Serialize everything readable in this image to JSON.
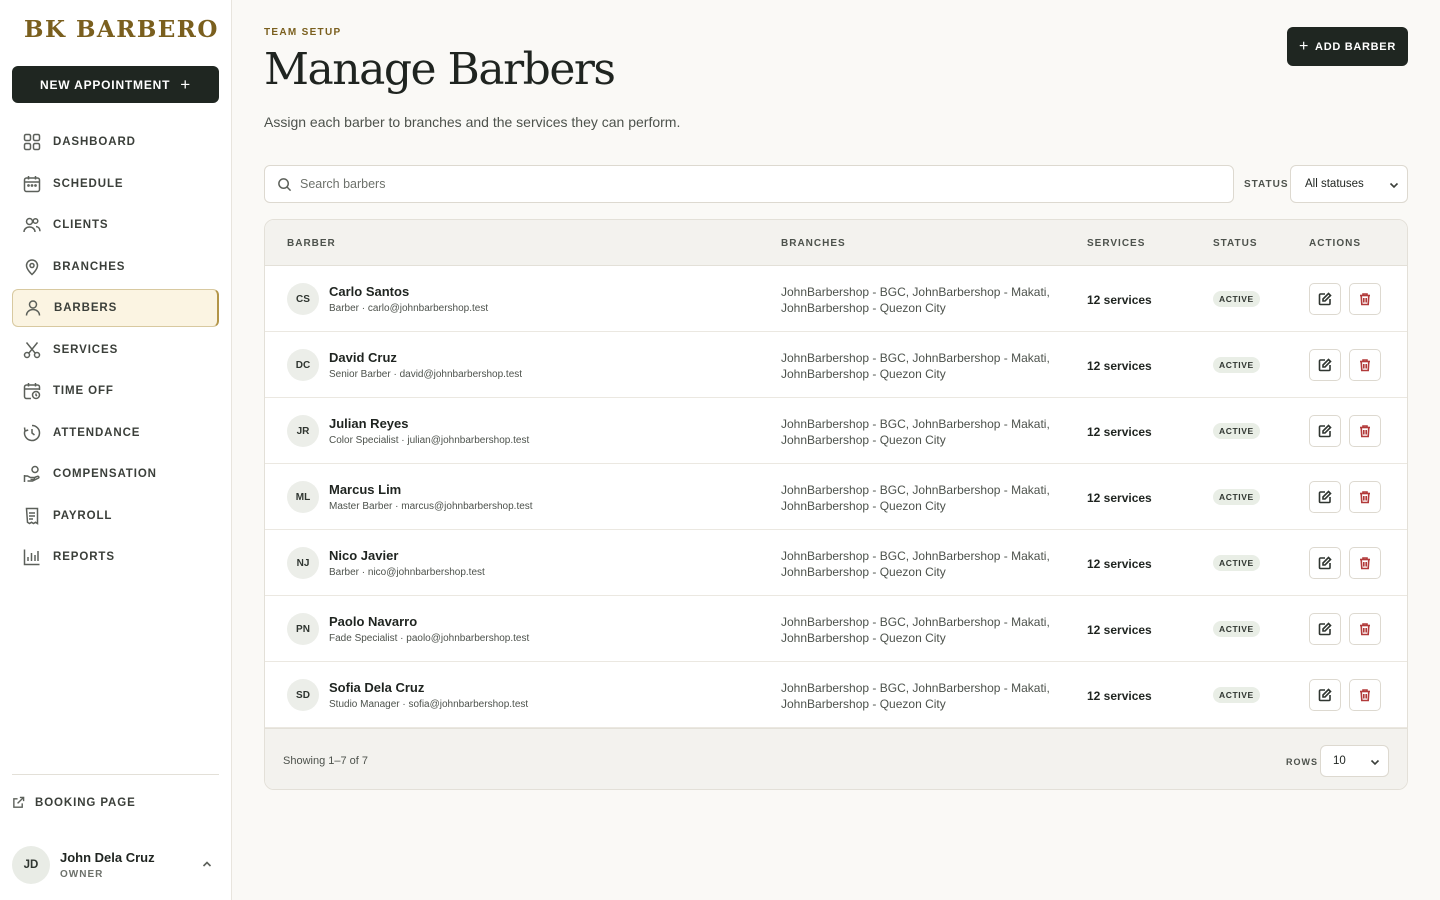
{
  "sidebar": {
    "brand": "BK BARBERO",
    "new_appointment": "NEW APPOINTMENT",
    "nav": [
      {
        "label": "DASHBOARD",
        "icon": "grid-icon"
      },
      {
        "label": "SCHEDULE",
        "icon": "calendar-icon"
      },
      {
        "label": "CLIENTS",
        "icon": "users-icon"
      },
      {
        "label": "BRANCHES",
        "icon": "map-pin-icon"
      },
      {
        "label": "BARBERS",
        "icon": "user-icon",
        "active": true
      },
      {
        "label": "SERVICES",
        "icon": "scissors-icon"
      },
      {
        "label": "TIME OFF",
        "icon": "calendar-clock-icon"
      },
      {
        "label": "ATTENDANCE",
        "icon": "clock-icon"
      },
      {
        "label": "COMPENSATION",
        "icon": "hand-coins-icon"
      },
      {
        "label": "PAYROLL",
        "icon": "receipt-icon"
      },
      {
        "label": "REPORTS",
        "icon": "bar-chart-icon"
      }
    ],
    "booking_page": "BOOKING PAGE",
    "user": {
      "initials": "JD",
      "name": "John Dela Cruz",
      "role": "OWNER"
    }
  },
  "header": {
    "eyebrow": "TEAM SETUP",
    "title": "Manage Barbers",
    "subtitle": "Assign each barber to branches and the services they can perform.",
    "add_button": "ADD BARBER"
  },
  "filters": {
    "search_placeholder": "Search barbers",
    "status_label": "STATUS",
    "status_value": "All statuses"
  },
  "table": {
    "columns": [
      "BARBER",
      "BRANCHES",
      "SERVICES",
      "STATUS",
      "ACTIONS"
    ],
    "rows": [
      {
        "initials": "CS",
        "name": "Carlo Santos",
        "meta": "Barber · carlo@johnbarbershop.test",
        "branches": "JohnBarbershop - BGC, JohnBarbershop - Makati, JohnBarbershop - Quezon City",
        "services": "12 services",
        "status": "ACTIVE"
      },
      {
        "initials": "DC",
        "name": "David Cruz",
        "meta": "Senior Barber · david@johnbarbershop.test",
        "branches": "JohnBarbershop - BGC, JohnBarbershop - Makati, JohnBarbershop - Quezon City",
        "services": "12 services",
        "status": "ACTIVE"
      },
      {
        "initials": "JR",
        "name": "Julian Reyes",
        "meta": "Color Specialist · julian@johnbarbershop.test",
        "branches": "JohnBarbershop - BGC, JohnBarbershop - Makati, JohnBarbershop - Quezon City",
        "services": "12 services",
        "status": "ACTIVE"
      },
      {
        "initials": "ML",
        "name": "Marcus Lim",
        "meta": "Master Barber · marcus@johnbarbershop.test",
        "branches": "JohnBarbershop - BGC, JohnBarbershop - Makati, JohnBarbershop - Quezon City",
        "services": "12 services",
        "status": "ACTIVE"
      },
      {
        "initials": "NJ",
        "name": "Nico Javier",
        "meta": "Barber · nico@johnbarbershop.test",
        "branches": "JohnBarbershop - BGC, JohnBarbershop - Makati, JohnBarbershop - Quezon City",
        "services": "12 services",
        "status": "ACTIVE"
      },
      {
        "initials": "PN",
        "name": "Paolo Navarro",
        "meta": "Fade Specialist · paolo@johnbarbershop.test",
        "branches": "JohnBarbershop - BGC, JohnBarbershop - Makati, JohnBarbershop - Quezon City",
        "services": "12 services",
        "status": "ACTIVE"
      },
      {
        "initials": "SD",
        "name": "Sofia Dela Cruz",
        "meta": "Studio Manager · sofia@johnbarbershop.test",
        "branches": "JohnBarbershop - BGC, JohnBarbershop - Makati, JohnBarbershop - Quezon City",
        "services": "12 services",
        "status": "ACTIVE"
      }
    ],
    "footer": {
      "showing": "Showing 1–7 of 7",
      "rows_label": "ROWS",
      "rows_value": "10"
    }
  },
  "colors": {
    "accent_gold": "#7a5f1e",
    "dark_button": "#1f2621",
    "active_nav_bg": "#fbf4e2",
    "delete_red": "#b23a3a"
  }
}
